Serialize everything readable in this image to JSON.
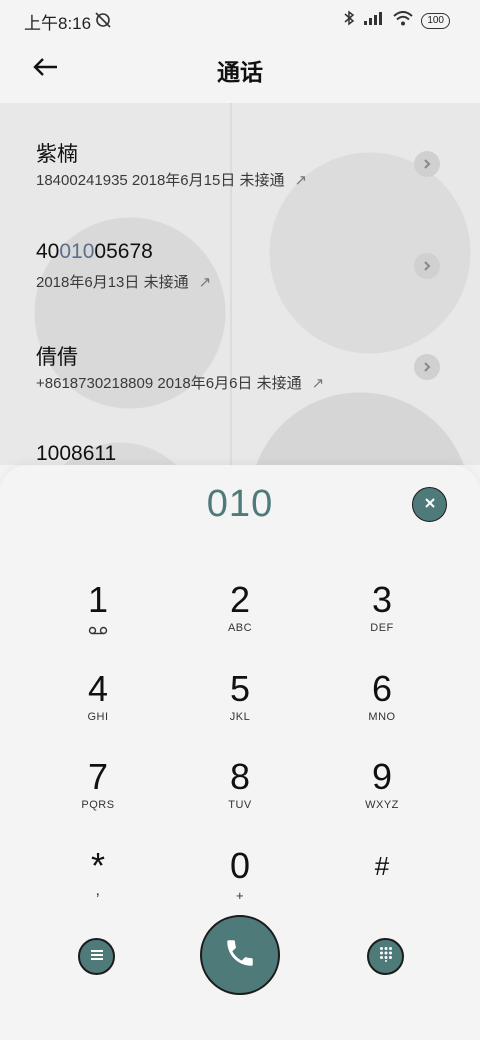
{
  "status_bar": {
    "time": "上午8:16",
    "battery": "100"
  },
  "header": {
    "title": "通话"
  },
  "call_log": [
    {
      "name": "紫楠",
      "detail": "18400241935  2018年6月15日  未接通",
      "arrow": "↗"
    },
    {
      "name_parts": [
        "40",
        "010",
        "05678"
      ],
      "detail": "2018年6月13日  未接通",
      "arrow": "↗"
    },
    {
      "name": "倩倩",
      "detail": "+8618730218809  2018年6月6日  未接通",
      "arrow": "↗"
    },
    {
      "name": "1008611"
    }
  ],
  "dialpad": {
    "input": "010",
    "keys": [
      {
        "digit": "1",
        "sub": ""
      },
      {
        "digit": "2",
        "sub": "ABC"
      },
      {
        "digit": "3",
        "sub": "DEF"
      },
      {
        "digit": "4",
        "sub": "GHI"
      },
      {
        "digit": "5",
        "sub": "JKL"
      },
      {
        "digit": "6",
        "sub": "MNO"
      },
      {
        "digit": "7",
        "sub": "PQRS"
      },
      {
        "digit": "8",
        "sub": "TUV"
      },
      {
        "digit": "9",
        "sub": "WXYZ"
      },
      {
        "digit": "*",
        "sub": ","
      },
      {
        "digit": "0",
        "sub": "+"
      },
      {
        "digit": "#",
        "sub": ""
      }
    ]
  },
  "colors": {
    "accent": "#4e7a7a",
    "highlight": "#5c6f8f",
    "background": "#f4f4f4"
  },
  "icons": {
    "back": "arrow-left-icon",
    "clear": "close-icon",
    "menu": "menu-icon",
    "call": "phone-icon",
    "keypad": "dialpad-icon",
    "voicemail": "voicemail-icon"
  }
}
